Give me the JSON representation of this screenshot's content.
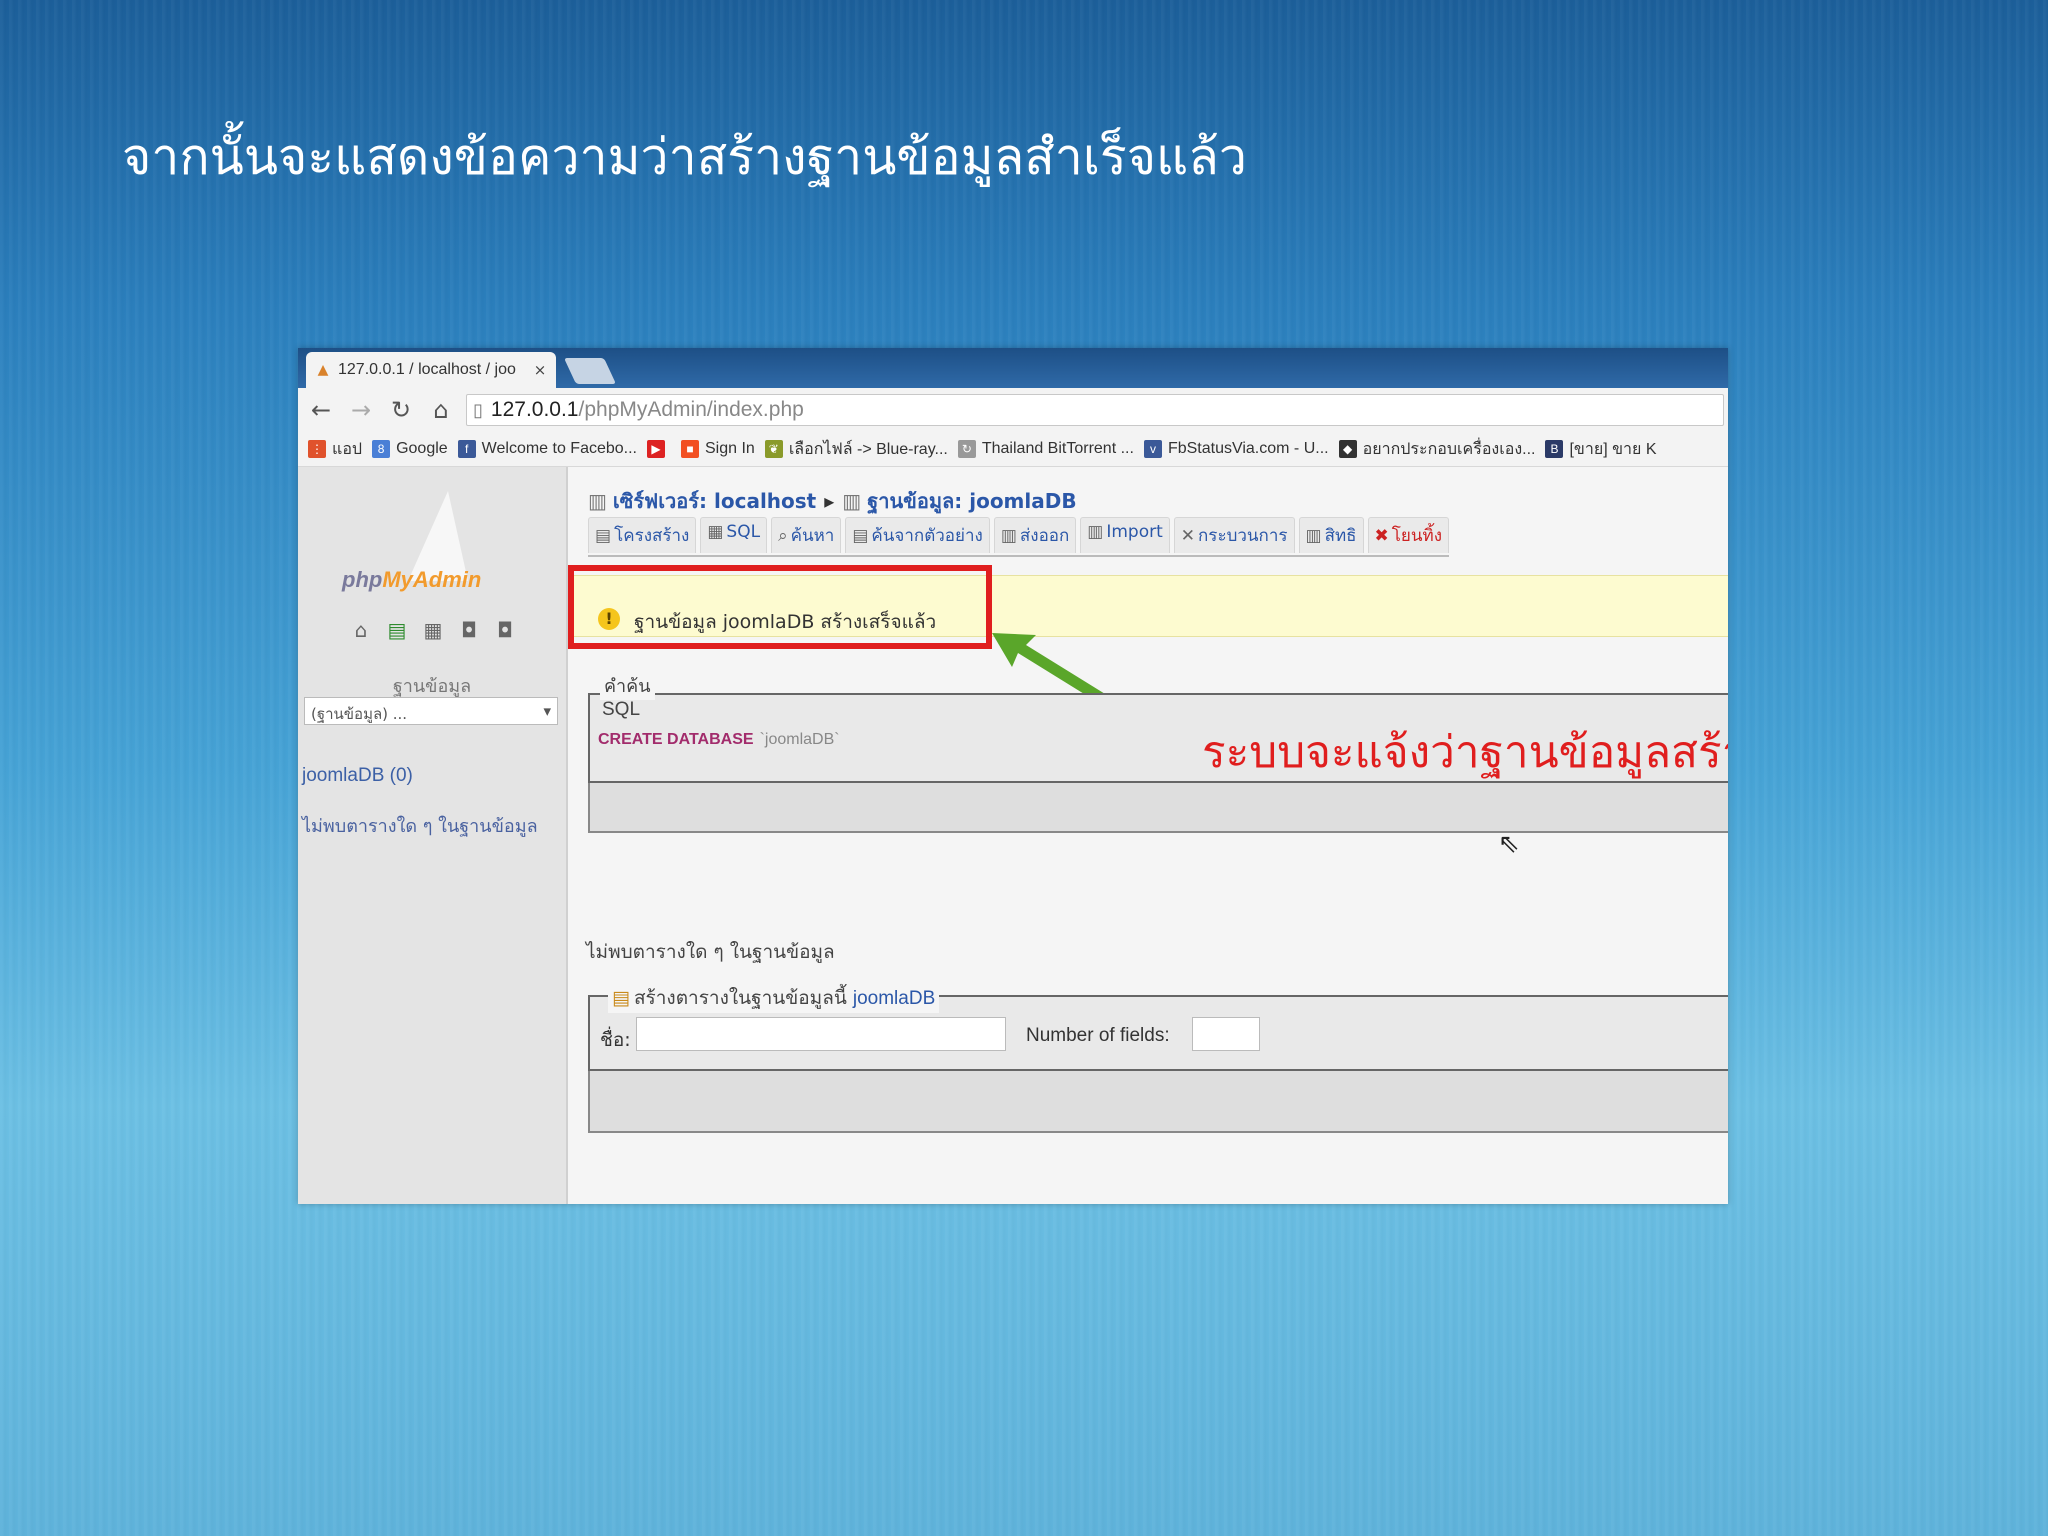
{
  "slide": {
    "title": "จากนั้นจะแสดงข้อความว่าสร้างฐานข้อมูลสำเร็จแล้ว"
  },
  "browser": {
    "tab_title": "127.0.0.1 / localhost / joo",
    "tab_close": "×",
    "url_host": "127.0.0.1",
    "url_path": "/phpMyAdmin/index.php",
    "bookmarks": [
      {
        "label": "แอป",
        "icon": "apps-icon",
        "color": "#e0522c"
      },
      {
        "label": "Google",
        "icon": "google-icon",
        "color": "#4a7fd6"
      },
      {
        "label": "Welcome to Facebo...",
        "icon": "facebook-icon",
        "color": "#3b5998"
      },
      {
        "label": "",
        "icon": "youtube-icon",
        "color": "#d22"
      },
      {
        "label": "Sign In",
        "icon": "windows-icon",
        "color": "#f25022"
      },
      {
        "label": "เลือกไฟล์ -> Blue-ray...",
        "icon": "leaf-icon",
        "color": "#8a9a2a"
      },
      {
        "label": "Thailand BitTorrent ...",
        "icon": "torrent-icon",
        "color": "#999"
      },
      {
        "label": "FbStatusVia.com - U...",
        "icon": "via-icon",
        "color": "#3b5998"
      },
      {
        "label": "อยากประกอบเครื่องเอง...",
        "icon": "diamond-icon",
        "color": "#333"
      },
      {
        "label": "[ขาย] ขาย K",
        "icon": "blogger-icon",
        "color": "#2b3a67"
      }
    ]
  },
  "pma": {
    "logo_php": "php",
    "logo_my": "MyAdmin",
    "side_label": "ฐานข้อมูล",
    "side_select": "(ฐานข้อมูล) ...",
    "side_db": "joomlaDB (0)",
    "side_note": "ไม่พบตารางใด ๆ ในฐานข้อมูล",
    "breadcrumb_server": "เซิร์ฟเวอร์: localhost",
    "breadcrumb_db": "ฐานข้อมูล: joomlaDB",
    "tabs": [
      {
        "label": "โครงสร้าง"
      },
      {
        "label": "SQL"
      },
      {
        "label": "ค้นหา"
      },
      {
        "label": "ค้นจากตัวอย่าง"
      },
      {
        "label": "ส่งออก"
      },
      {
        "label": "Import"
      },
      {
        "label": "กระบวนการ"
      },
      {
        "label": "สิทธิ"
      },
      {
        "label": "โยนทิ้ง"
      }
    ],
    "notice": "ฐานข้อมูล joomlaDB สร้างเสร็จแล้ว",
    "query_legend": "คำค้น",
    "query_sql_label": "SQL",
    "query_code": "CREATE DATABASE",
    "query_db": "`joomlaDB`",
    "annotation": "ระบบจะแจ้งว่าฐานข้อมูลสร้างเสร็จแล้ว",
    "no_tables": "ไม่พบตารางใด ๆ ในฐานข้อมูล",
    "create_legend": "สร้างตารางในฐานข้อมูลนี้",
    "create_db": "joomlaDB",
    "name_label": "ชื่อ:",
    "fields_label": "Number of fields:"
  },
  "colors": {
    "highlight": "#e01e1e",
    "arrow": "#5aa62a",
    "link": "#2b57a8"
  }
}
